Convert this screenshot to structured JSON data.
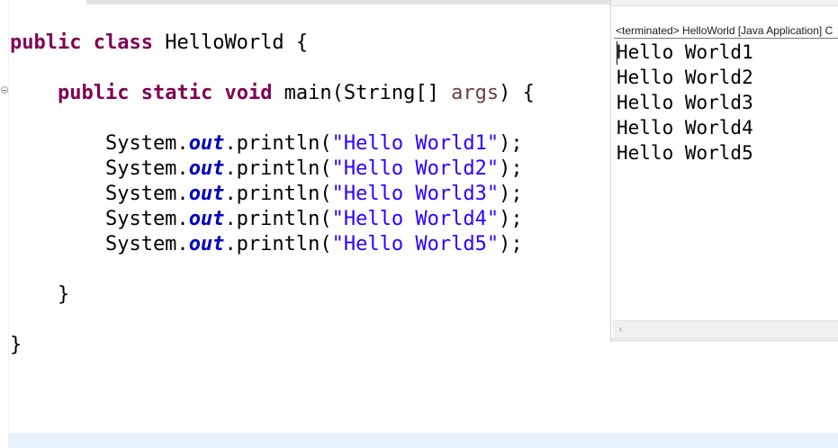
{
  "editor": {
    "lines": [
      {
        "tokens": [
          {
            "t": "public",
            "c": "kw"
          },
          {
            "t": " "
          },
          {
            "t": "class",
            "c": "kw"
          },
          {
            "t": " HelloWorld {"
          }
        ]
      },
      {
        "tokens": [
          {
            "t": "    "
          },
          {
            "t": "public",
            "c": "kw"
          },
          {
            "t": " "
          },
          {
            "t": "static",
            "c": "kw"
          },
          {
            "t": " "
          },
          {
            "t": "void",
            "c": "kw"
          },
          {
            "t": " main(String[] "
          },
          {
            "t": "args",
            "c": "prm"
          },
          {
            "t": ") {"
          }
        ]
      },
      {
        "tokens": [
          {
            "t": "        System."
          },
          {
            "t": "out",
            "c": "fld"
          },
          {
            "t": ".println("
          },
          {
            "t": "\"Hello World1\"",
            "c": "str"
          },
          {
            "t": ");"
          }
        ]
      },
      {
        "tokens": [
          {
            "t": "        System."
          },
          {
            "t": "out",
            "c": "fld"
          },
          {
            "t": ".println("
          },
          {
            "t": "\"Hello World2\"",
            "c": "str"
          },
          {
            "t": ");"
          }
        ]
      },
      {
        "tokens": [
          {
            "t": "        System."
          },
          {
            "t": "out",
            "c": "fld"
          },
          {
            "t": ".println("
          },
          {
            "t": "\"Hello World3\"",
            "c": "str"
          },
          {
            "t": ");"
          }
        ]
      },
      {
        "tokens": [
          {
            "t": "        System."
          },
          {
            "t": "out",
            "c": "fld"
          },
          {
            "t": ".println("
          },
          {
            "t": "\"Hello World4\"",
            "c": "str"
          },
          {
            "t": ");"
          }
        ]
      },
      {
        "tokens": [
          {
            "t": "        System."
          },
          {
            "t": "out",
            "c": "fld"
          },
          {
            "t": ".println("
          },
          {
            "t": "\"Hello World5\"",
            "c": "str"
          },
          {
            "t": ");"
          }
        ]
      },
      {
        "tokens": [
          {
            "t": "    }"
          }
        ]
      },
      {
        "tokens": [
          {
            "t": "}"
          }
        ]
      }
    ]
  },
  "console": {
    "header": "<terminated> HelloWorld [Java Application] C",
    "output": [
      "Hello World1",
      "Hello World2",
      "Hello World3",
      "Hello World4",
      "Hello World5"
    ]
  },
  "colors": {
    "keyword": "#7f0055",
    "field": "#0000c0",
    "string": "#2a00ff",
    "parameter": "#6a3e3e",
    "highlight_band": "#e8f2fe"
  },
  "icons": {
    "fold": "fold-collapse-icon",
    "scroll_left": "scroll-left-arrow-icon"
  }
}
